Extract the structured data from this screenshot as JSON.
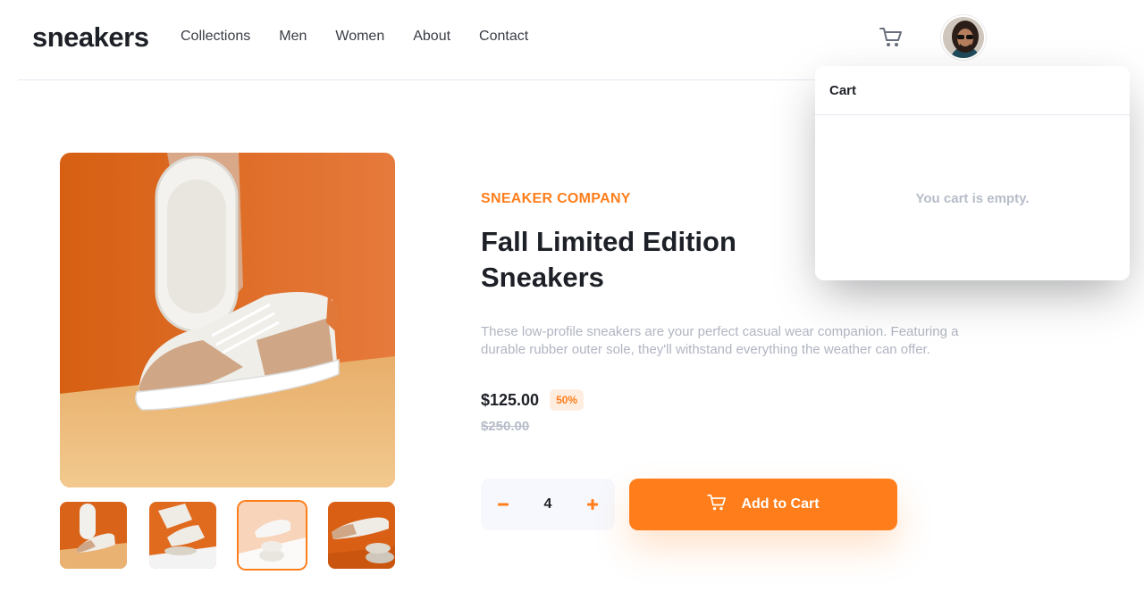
{
  "header": {
    "logo": "sneakers",
    "nav": [
      "Collections",
      "Men",
      "Women",
      "About",
      "Contact"
    ],
    "cart_icon": "cart-icon",
    "avatar_icon": "avatar"
  },
  "product": {
    "company": "SNEAKER COMPANY",
    "title": "Fall Limited Edition Sneakers",
    "description": "These low-profile sneakers are your perfect casual wear companion. Featuring a durable rubber outer sole, they'll withstand everything the weather can offer.",
    "price": "$125.00",
    "discount": "50%",
    "original_price": "$250.00"
  },
  "quantity": {
    "value": "4",
    "minus_icon": "minus-icon",
    "plus_icon": "plus-icon"
  },
  "add_to_cart": {
    "label": "Add to Cart",
    "icon": "cart-icon"
  },
  "cart_panel": {
    "title": "Cart",
    "empty_message": "You cart is empty."
  },
  "gallery": {
    "active_thumbnail": 3,
    "thumbnail_count": 4
  },
  "colors": {
    "accent": "#ff7e1b",
    "accent_pale": "#ffede0",
    "text_dark": "#1d2026",
    "text_muted": "#b0b5c2"
  }
}
